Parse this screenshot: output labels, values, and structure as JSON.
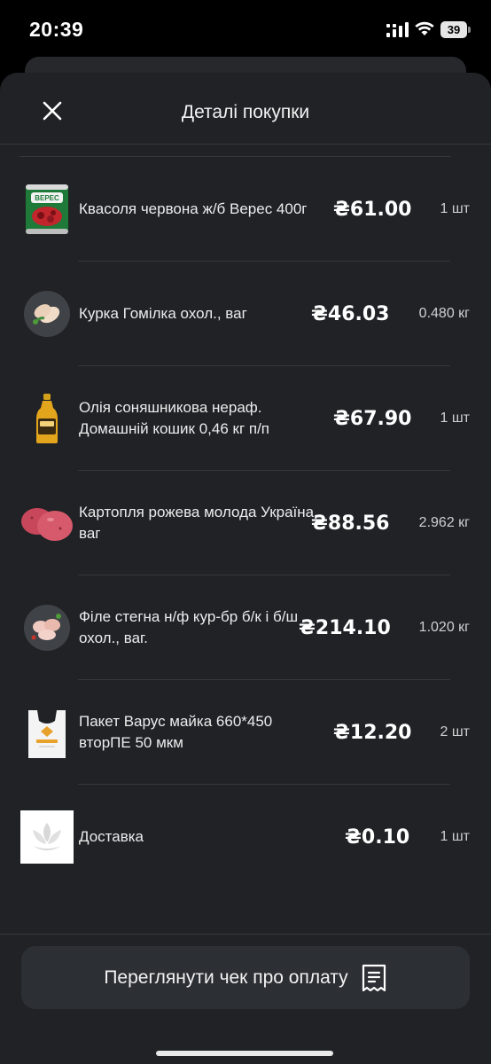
{
  "status_bar": {
    "time": "20:39",
    "battery": "39"
  },
  "header": {
    "title": "Деталі покупки",
    "close_icon": "close-icon"
  },
  "items": [
    {
      "name": "Квасоля червона ж/б Верес 400г",
      "price": "₴61.00",
      "qty": "1 шт",
      "thumb": "can-icon"
    },
    {
      "name": "Курка Гомілка охол., ваг",
      "price": "₴46.03",
      "qty": "0.480 кг",
      "thumb": "chicken-leg-icon"
    },
    {
      "name": "Олія соняшникова нераф. Домашній кошик 0,46 кг п/п",
      "price": "₴67.90",
      "qty": "1 шт",
      "thumb": "oil-bottle-icon"
    },
    {
      "name": "Картопля рожева молода Україна, ваг",
      "price": "₴88.56",
      "qty": "2.962 кг",
      "thumb": "potato-icon"
    },
    {
      "name": "Філе стегна н/ф кур-бр  б/к і б/ш охол., ваг.",
      "price": "₴214.10",
      "qty": "1.020 кг",
      "thumb": "chicken-fillet-icon"
    },
    {
      "name": "Пакет Варус майка 660*450 вторПЕ 50 мкм",
      "price": "₴12.20",
      "qty": "2 шт",
      "thumb": "bag-icon"
    },
    {
      "name": "Доставка",
      "price": "₴0.10",
      "qty": "1 шт",
      "thumb": "delivery-placeholder-icon"
    }
  ],
  "footer": {
    "receipt_button_label": "Переглянути чек про оплату",
    "receipt_icon": "receipt-icon"
  },
  "colors": {
    "sheet": "#202226",
    "button": "#2c2f34",
    "divider": "#34373c"
  }
}
